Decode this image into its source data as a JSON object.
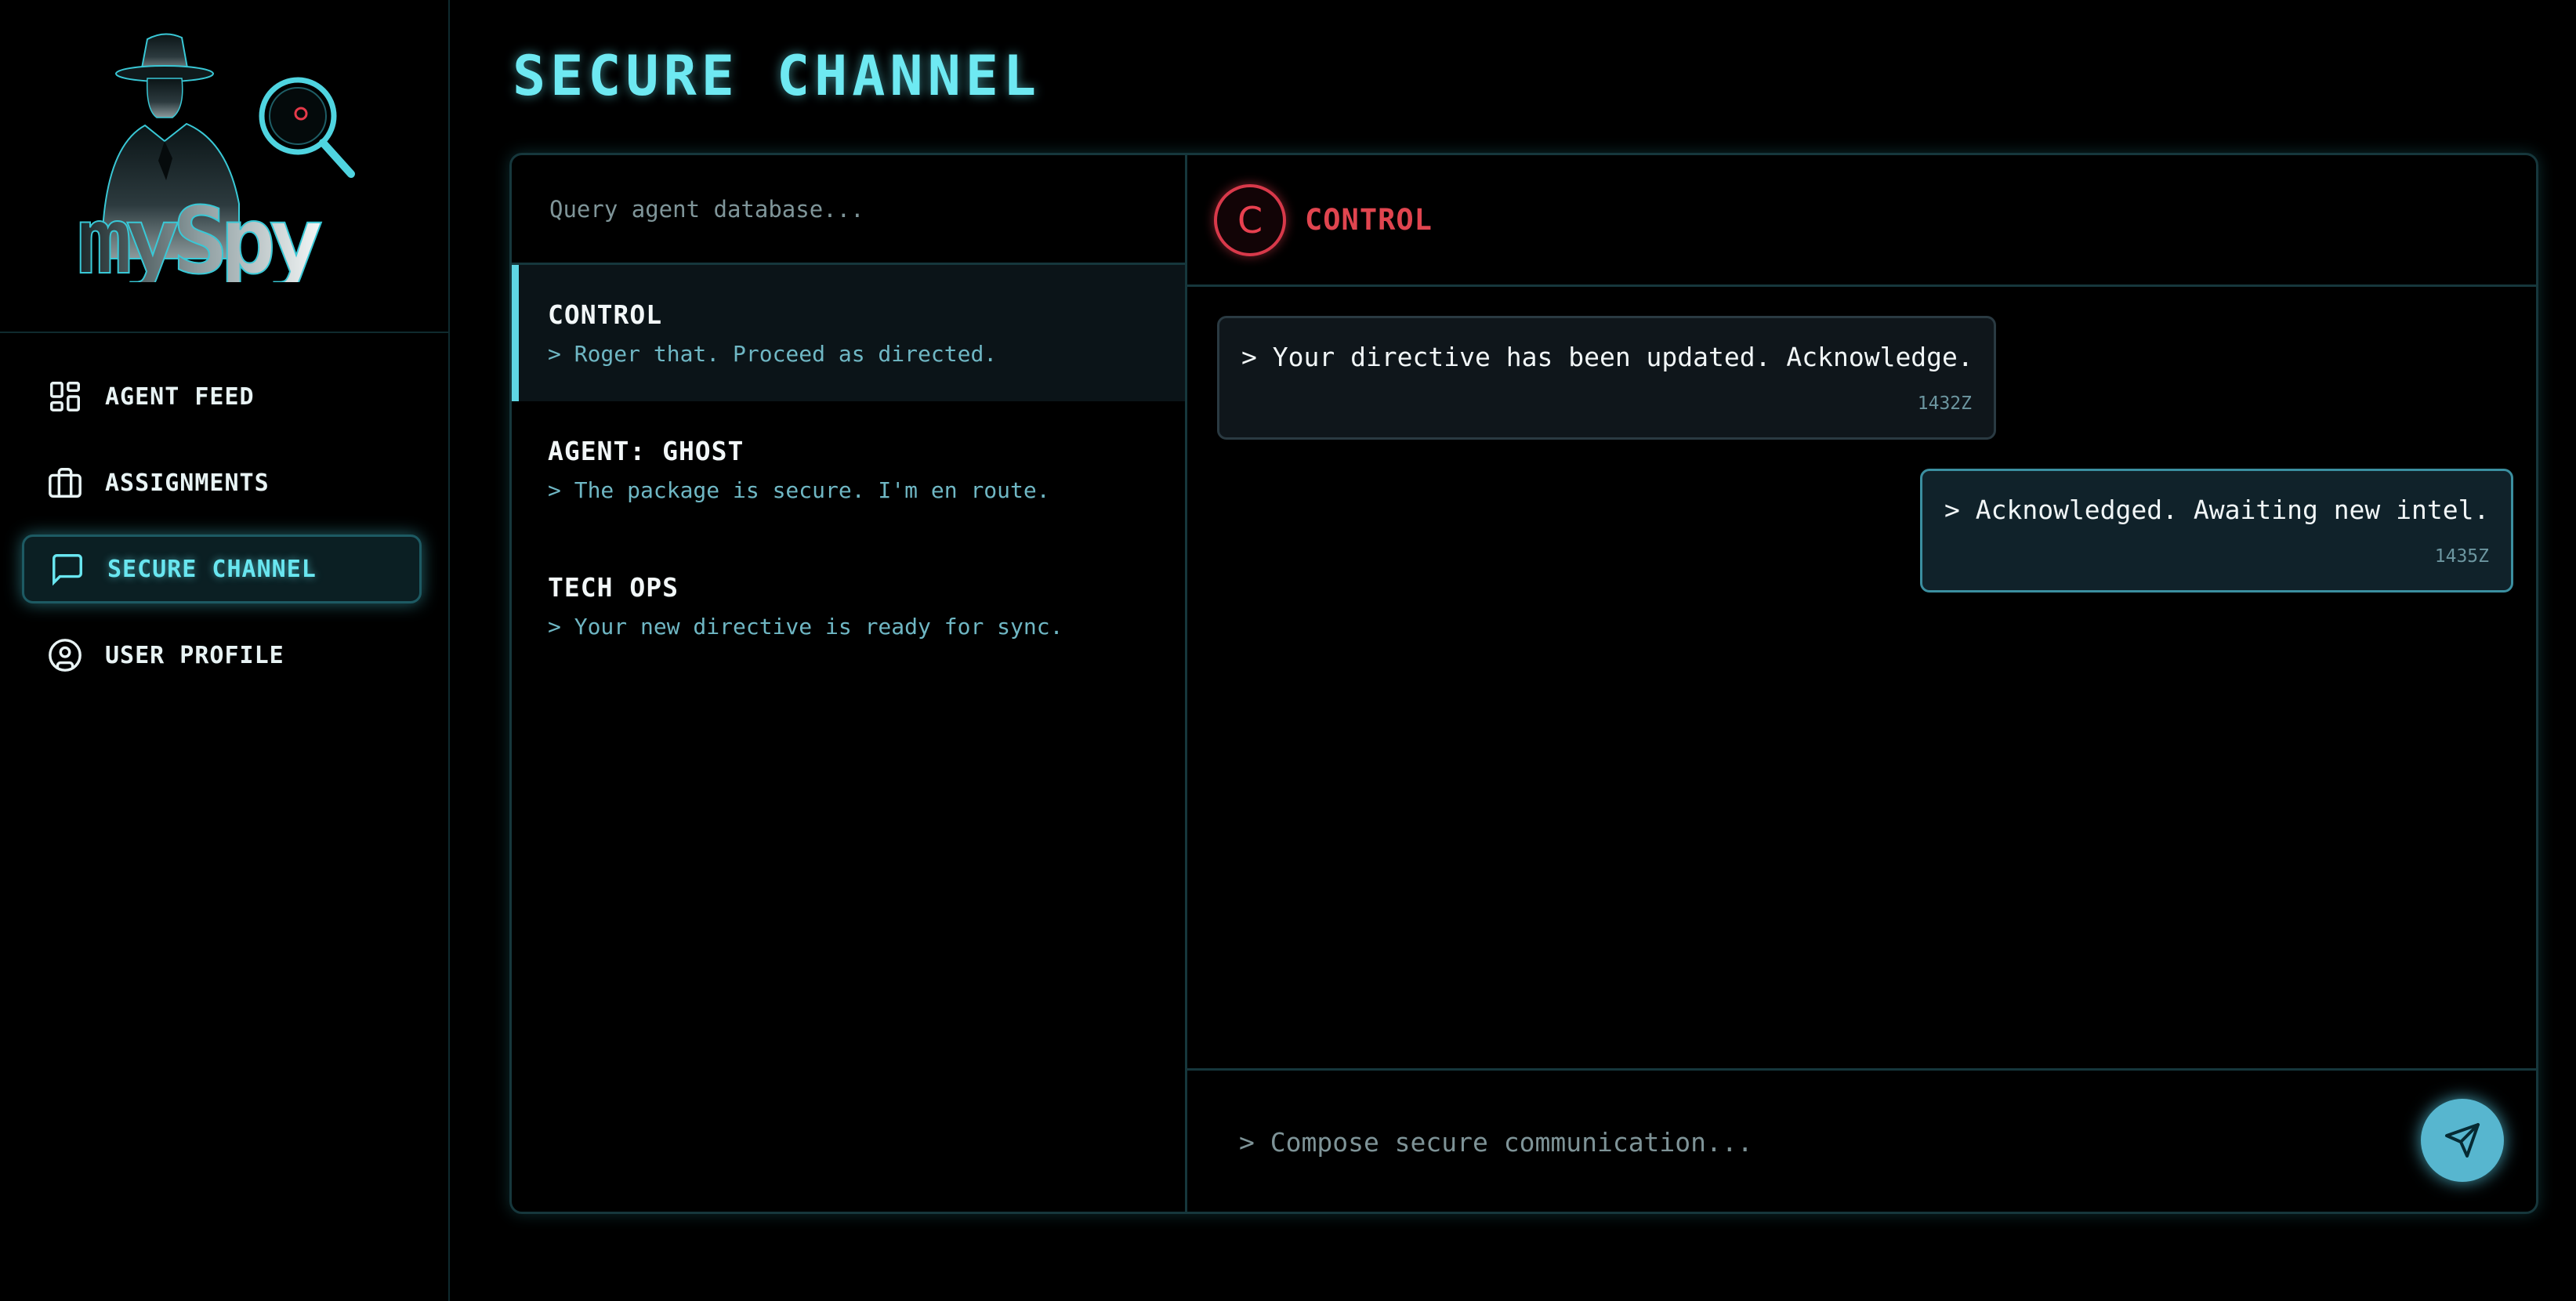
{
  "app": {
    "logo_text": "mySpy"
  },
  "sidebar": {
    "items": [
      {
        "label": "AGENT FEED",
        "icon": "dashboard-icon",
        "active": false
      },
      {
        "label": "ASSIGNMENTS",
        "icon": "briefcase-icon",
        "active": false
      },
      {
        "label": "SECURE CHANNEL",
        "icon": "chat-bubble-icon",
        "active": true
      },
      {
        "label": "USER PROFILE",
        "icon": "user-circle-icon",
        "active": false
      }
    ]
  },
  "page": {
    "title": "SECURE CHANNEL"
  },
  "search": {
    "placeholder": "Query agent database..."
  },
  "conversations": [
    {
      "name": "CONTROL",
      "preview": "> Roger that. Proceed as directed.",
      "selected": true
    },
    {
      "name": "AGENT: GHOST",
      "preview": "> The package is secure. I'm en route.",
      "selected": false
    },
    {
      "name": "TECH OPS",
      "preview": "> Your new directive is ready for sync.",
      "selected": false
    }
  ],
  "chat": {
    "avatar_letter": "C",
    "contact_name": "CONTROL",
    "messages": [
      {
        "direction": "in",
        "text": "> Your directive has been updated. Acknowledge.",
        "time": "1432Z"
      },
      {
        "direction": "out",
        "text": "> Acknowledged. Awaiting new intel.",
        "time": "1435Z"
      }
    ],
    "composer_placeholder": "> Compose secure communication..."
  },
  "colors": {
    "accent_cyan": "#6ee9f2",
    "alert_red": "#e0454f",
    "background": "#000000",
    "send_button": "#57b6cf"
  }
}
